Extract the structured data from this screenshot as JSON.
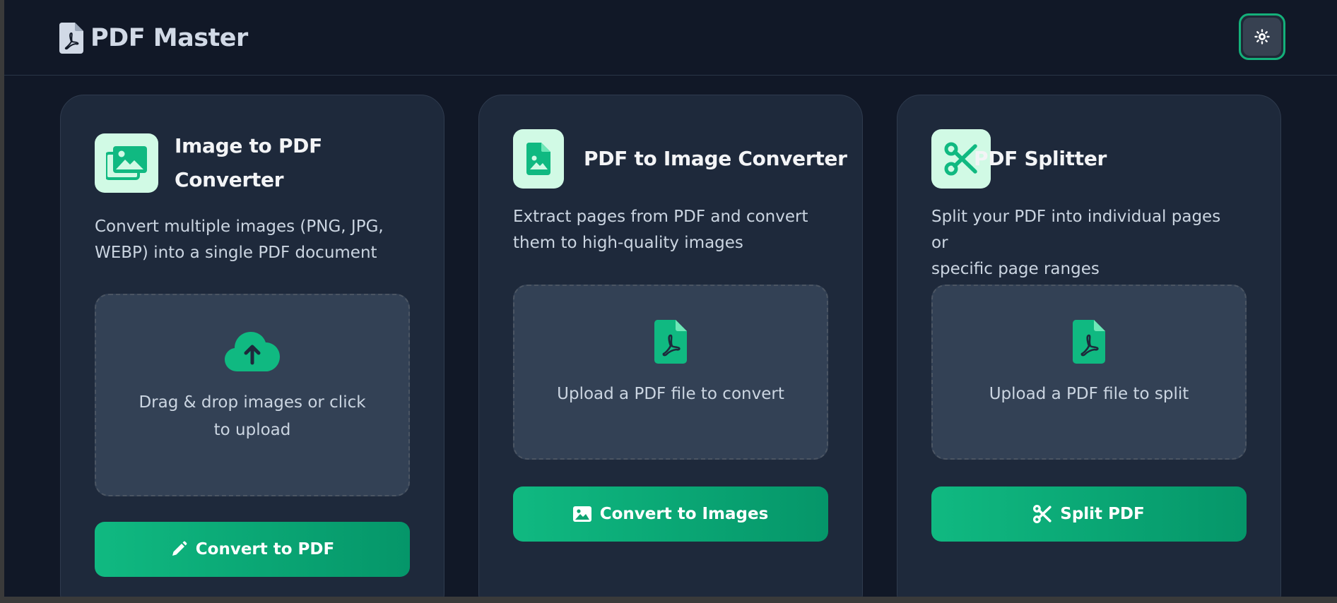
{
  "app": {
    "title": "PDF Master"
  },
  "header": {
    "theme_toggle_icon": "sun-icon"
  },
  "colors": {
    "background": "#111827",
    "card": "#1e293b",
    "accent": "#10b981",
    "accent_dark": "#059669",
    "icon_bg": "#d1fae5"
  },
  "cards": [
    {
      "icon": "images-icon",
      "title_line1": "Image to PDF",
      "title_line2": "Converter",
      "description_line1": "Convert multiple images (PNG, JPG,",
      "description_line2": "WEBP) into a single PDF document",
      "dropzone_icon": "cloud-upload-icon",
      "dropzone_line1": "Drag & drop images or click",
      "dropzone_line2": "to upload",
      "button_icon": "pencil-icon",
      "button_label": "Convert to PDF"
    },
    {
      "icon": "file-image-icon",
      "title": "PDF to Image Converter",
      "description_line1": "Extract pages from PDF and convert",
      "description_line2": "them to high-quality images",
      "dropzone_icon": "file-pdf-icon",
      "dropzone_text": "Upload a PDF file to convert",
      "button_icon": "image-icon",
      "button_label": "Convert to Images"
    },
    {
      "icon": "scissors-icon",
      "title": "PDF Splitter",
      "description_line1": "Split your PDF into individual pages or",
      "description_line2": "specific page ranges",
      "dropzone_icon": "file-pdf-icon",
      "dropzone_text": "Upload a PDF file to split",
      "button_icon": "scissors-icon",
      "button_label": "Split PDF"
    }
  ]
}
